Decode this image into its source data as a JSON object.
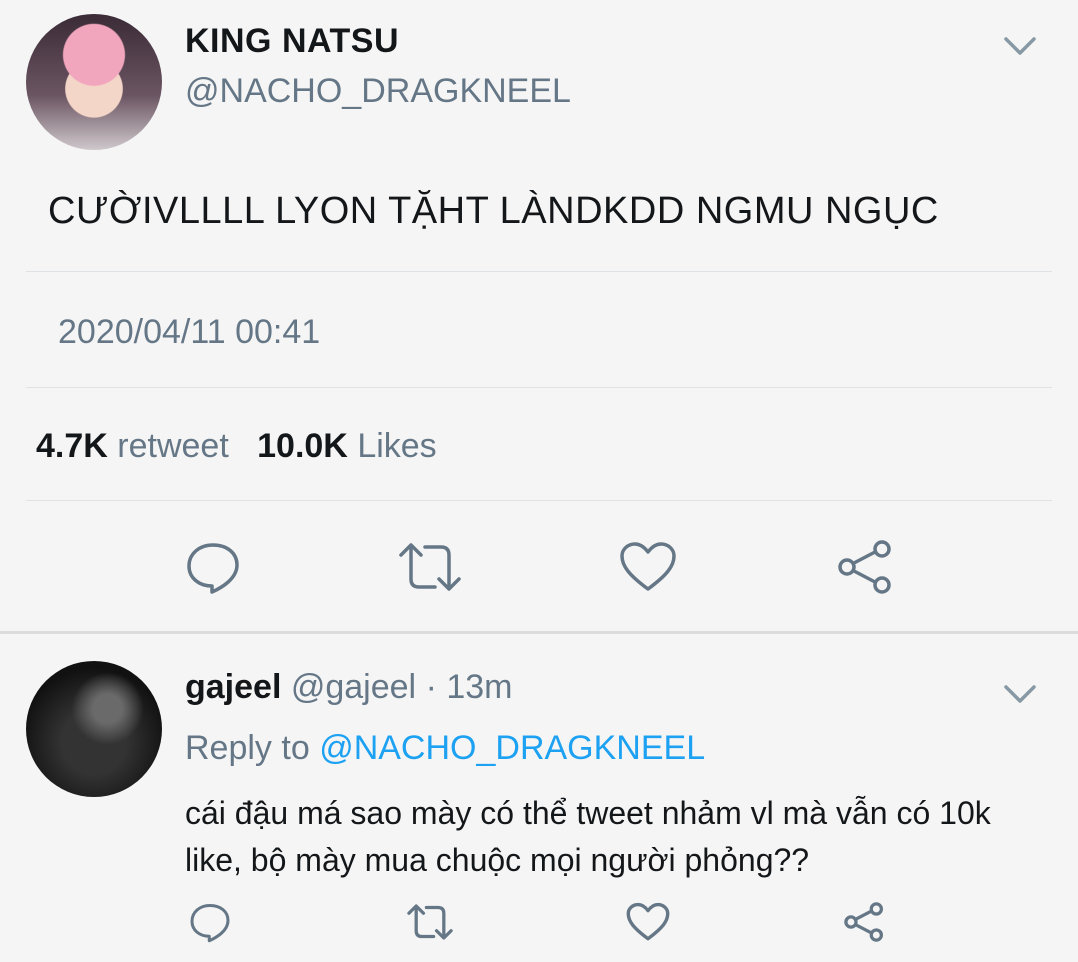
{
  "tweet": {
    "name": "KING NATSU",
    "handle": "@NACHO_DRAGKNEEL",
    "text": "CƯỜIVLLLL LYON TẶHT LÀNDKDD NGMU NGỤC",
    "timestamp": "2020/04/11 00:41",
    "retweet_count": "4.7K",
    "retweet_label": "retweet",
    "likes_count": "10.0K",
    "likes_label": "Likes"
  },
  "reply": {
    "name": "gajeel",
    "handle": "@gajeel",
    "separator": "·",
    "time": "13m",
    "reply_to_label": "Reply to",
    "reply_to_handle": "@NACHO_DRAGKNEEL",
    "text": "cái đậu má sao mày có thể tweet nhảm vl mà vẫn có 10k like, bộ mày mua chuộc mọi người phỏng??"
  },
  "icons": [
    "chevron-down-icon",
    "reply-icon",
    "retweet-icon",
    "heart-icon",
    "share-icon"
  ],
  "colors": {
    "secondary_text": "#657786",
    "mention": "#1da1f2",
    "background": "#f5f5f5"
  }
}
